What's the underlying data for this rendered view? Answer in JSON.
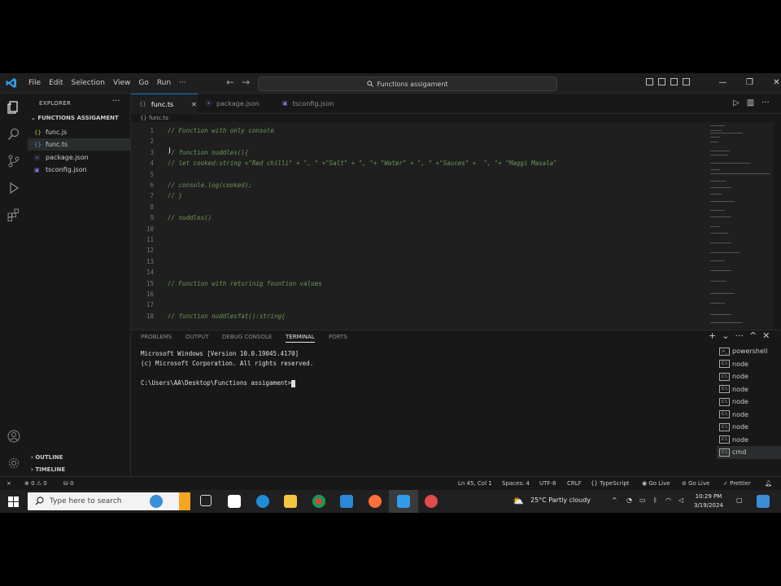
{
  "menu": [
    "File",
    "Edit",
    "Selection",
    "View",
    "Go",
    "Run",
    "···"
  ],
  "command_center": "Functions assigament",
  "sidebar": {
    "title": "EXPLORER",
    "more": "···",
    "folder": "FUNCTIONS ASSIGAMENT",
    "files": [
      {
        "icon": "{}",
        "name": "func.js"
      },
      {
        "icon": "{}",
        "name": "func.ts"
      },
      {
        "icon": "⦿",
        "name": "package.json"
      },
      {
        "icon": "▣",
        "name": "tsconfig.json"
      }
    ],
    "outline": "OUTLINE",
    "timeline": "TIMELINE"
  },
  "tabs": [
    {
      "icon": "{}",
      "label": "func.ts",
      "close": "✕"
    },
    {
      "icon": "⦿",
      "label": "package.json"
    },
    {
      "icon": "▣",
      "label": "tsconfig.json"
    }
  ],
  "breadcrumb": "{} func.ts",
  "code_lines": [
    {
      "n": "1",
      "text": "// Function with only console"
    },
    {
      "n": "2",
      "text": ""
    },
    {
      "n": "3",
      "text": "// function nuddles(){"
    },
    {
      "n": "4",
      "text": "// let cooked:string =\"Red chilli\" + \", \" +\"Salt\" + \", \"+ \"Water\" + \", \" +\"Sauces\" +  \", \"+ \"Maggi Masala\""
    },
    {
      "n": "5",
      "text": ""
    },
    {
      "n": "6",
      "text": "// console.log(cooked);"
    },
    {
      "n": "7",
      "text": "// }"
    },
    {
      "n": "8",
      "text": ""
    },
    {
      "n": "9",
      "text": "// nuddles()"
    },
    {
      "n": "10",
      "text": ""
    },
    {
      "n": "11",
      "text": ""
    },
    {
      "n": "12",
      "text": ""
    },
    {
      "n": "13",
      "text": ""
    },
    {
      "n": "14",
      "text": ""
    },
    {
      "n": "15",
      "text": "// Function with returinig fountion values"
    },
    {
      "n": "16",
      "text": ""
    },
    {
      "n": "17",
      "text": ""
    },
    {
      "n": "18",
      "text": "// function nuddlesfat():string{"
    }
  ],
  "panel": {
    "tabs": [
      "PROBLEMS",
      "OUTPUT",
      "DEBUG CONSOLE",
      "TERMINAL",
      "PORTS"
    ],
    "active_tab": "TERMINAL",
    "terminal_lines": [
      "Microsoft Windows [Version 10.0.19045.4170]",
      "(c) Microsoft Corporation. All rights reserved.",
      "",
      "C:\\Users\\AA\\Desktop\\Functions assigament>"
    ],
    "terminals": [
      "powershell",
      "node",
      "node",
      "node",
      "node",
      "node",
      "node",
      "node",
      "cmd"
    ]
  },
  "statusbar": {
    "errors": "⊗ 0 ⚠ 0",
    "ports": "⛁ 0",
    "position": "Ln 45, Col 1",
    "spaces": "Spaces: 4",
    "encoding": "UTF-8",
    "eol": "CRLF",
    "language": "TypeScript",
    "golive1": "Go Live",
    "golive2": "Go Live",
    "prettier": "Prettier"
  },
  "taskbar": {
    "search_placeholder": "Type here to search",
    "weather": "25°C  Partly cloudy",
    "time": "10:29 PM",
    "date": "3/19/2024"
  },
  "colors": {
    "accent": "#0078d4",
    "comment": "#6a9955",
    "bg": "#1f1f1f"
  }
}
